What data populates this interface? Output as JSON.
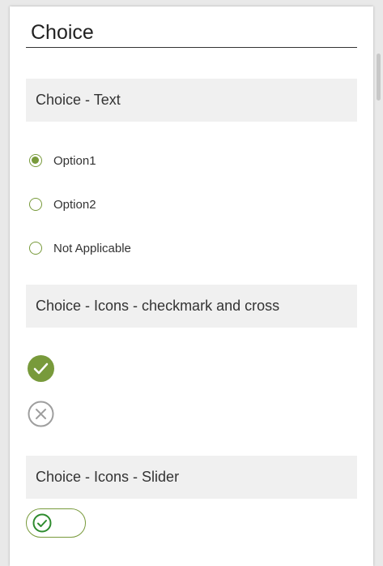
{
  "page": {
    "title": "Choice"
  },
  "sections": {
    "text": {
      "header": "Choice - Text",
      "options": [
        {
          "label": "Option1",
          "selected": true
        },
        {
          "label": "Option2",
          "selected": false
        },
        {
          "label": "Not Applicable",
          "selected": false
        }
      ]
    },
    "icons": {
      "header": "Choice - Icons - checkmark and cross",
      "items": [
        "checkmark-icon",
        "cross-icon"
      ]
    },
    "slider": {
      "header": "Choice - Icons - Slider",
      "state_icon": "checkmark-icon"
    }
  },
  "colors": {
    "accent": "#789a3b",
    "cross": "#9e9e9e",
    "header_bg": "#f0f0f0"
  }
}
